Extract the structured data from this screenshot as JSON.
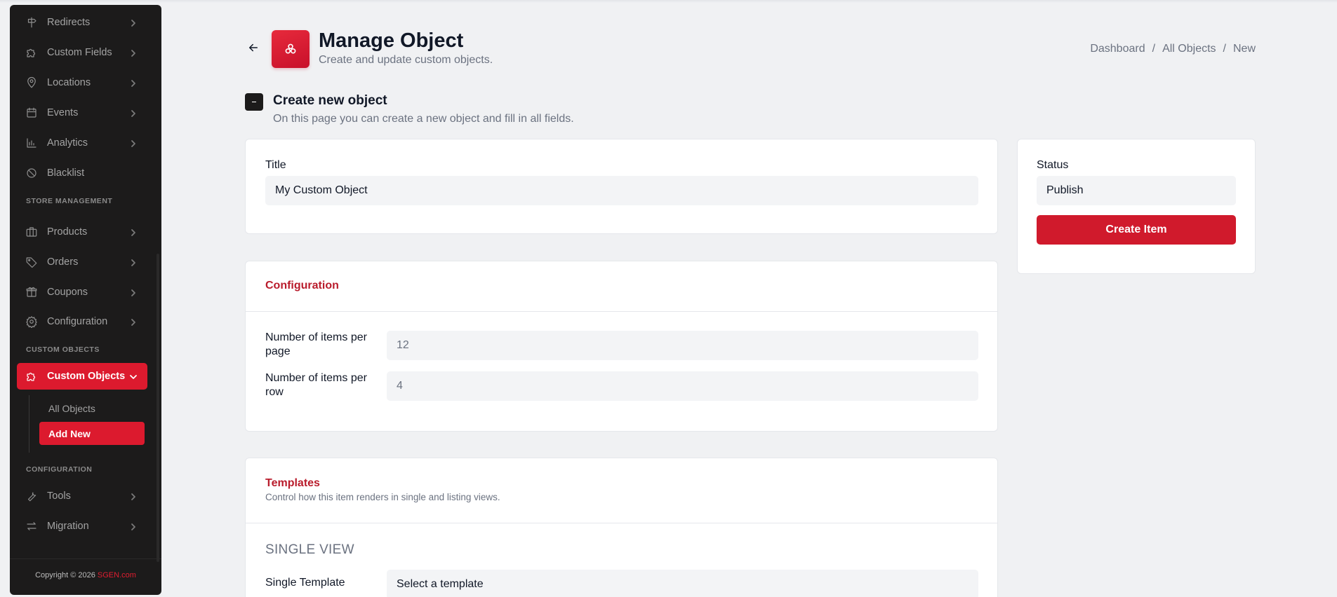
{
  "sidebar": {
    "items_top": [
      {
        "label": "Redirects",
        "icon": "signpost-icon"
      },
      {
        "label": "Custom Fields",
        "icon": "puzzle-icon"
      },
      {
        "label": "Locations",
        "icon": "map-pin-icon"
      },
      {
        "label": "Events",
        "icon": "calendar-icon"
      },
      {
        "label": "Analytics",
        "icon": "bar-chart-icon"
      },
      {
        "label": "Blacklist",
        "icon": "ban-icon"
      }
    ],
    "section_store": "STORE MANAGEMENT",
    "items_store": [
      {
        "label": "Products",
        "icon": "briefcase-icon"
      },
      {
        "label": "Orders",
        "icon": "tag-icon"
      },
      {
        "label": "Coupons",
        "icon": "gift-icon"
      },
      {
        "label": "Configuration",
        "icon": "gear-icon"
      }
    ],
    "section_custom": "CUSTOM OBJECTS",
    "custom_objects": {
      "label": "Custom Objects",
      "icon": "puzzle-icon"
    },
    "sub_items": [
      {
        "label": "All Objects"
      },
      {
        "label": "Add New"
      }
    ],
    "section_config": "CONFIGURATION",
    "items_config": [
      {
        "label": "Tools",
        "icon": "wrench-icon"
      },
      {
        "label": "Migration",
        "icon": "arrows-swap-icon"
      }
    ],
    "copyright_prefix": "Copyright © 2026",
    "copyright_brand": "SGEN.com"
  },
  "header": {
    "title": "Manage Object",
    "subtitle": "Create and update custom objects.",
    "breadcrumb": [
      "Dashboard",
      "/",
      "All Objects",
      "/",
      "New"
    ]
  },
  "create_section": {
    "title": "Create new object",
    "description": "On this page you can create a new object and fill in all fields."
  },
  "title_card": {
    "label": "Title",
    "value": "My Custom Object"
  },
  "status_card": {
    "label": "Status",
    "value": "Publish",
    "button": "Create Item"
  },
  "configuration": {
    "title": "Configuration",
    "fields": [
      {
        "label_line1": "Number of items per",
        "label_line2": "page",
        "value": "12"
      },
      {
        "label_line1": "Number of items per",
        "label_line2": "row",
        "value": "4"
      }
    ]
  },
  "templates": {
    "title": "Templates",
    "description": "Control how this item renders in single and listing views.",
    "single_view_heading": "SINGLE VIEW",
    "single_template_label": "Single Template",
    "single_template_value": "Select a template"
  },
  "colors": {
    "accent": "#dc1a2e",
    "sidebar_bg": "#1c1b1b",
    "page_bg": "#f0f1f3",
    "section_title": "#b91c2c"
  }
}
